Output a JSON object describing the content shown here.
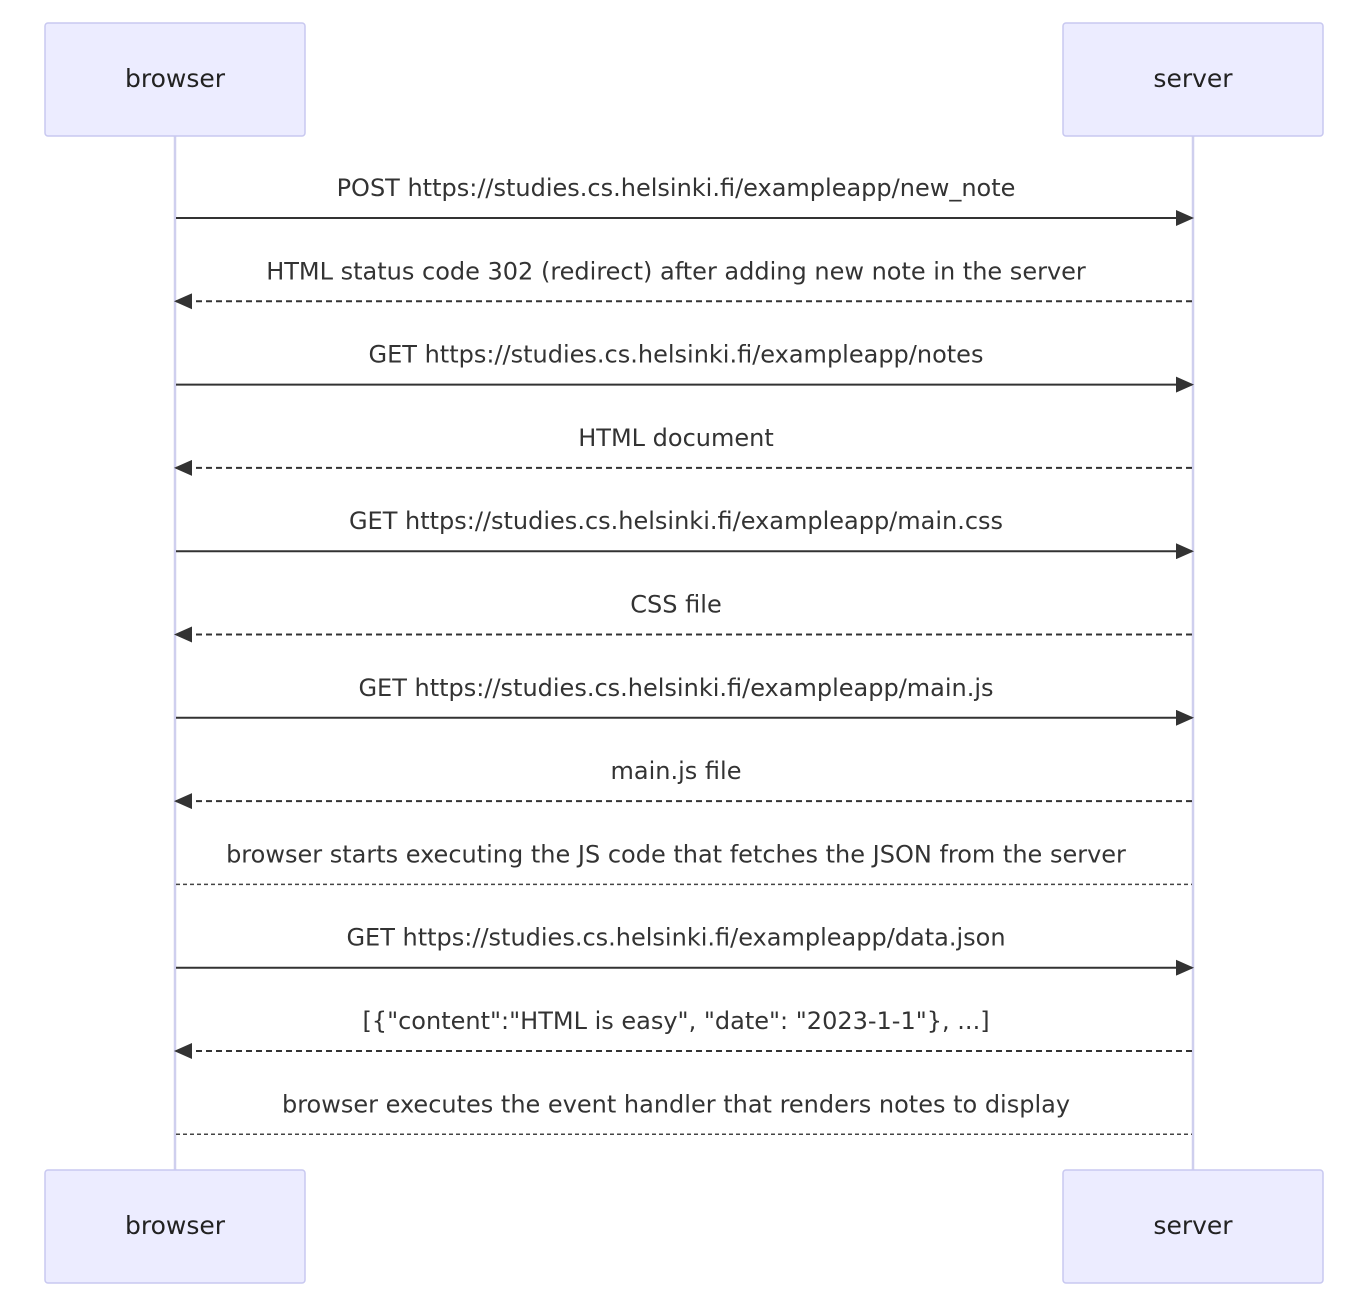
{
  "participants": [
    {
      "id": "browser",
      "label": "browser"
    },
    {
      "id": "server",
      "label": "server"
    }
  ],
  "messages": [
    {
      "kind": "request",
      "label": "POST https://studies.cs.helsinki.fi/exampleapp/new_note"
    },
    {
      "kind": "response",
      "label": "HTML status code 302 (redirect) after adding new note in the server"
    },
    {
      "kind": "request",
      "label": "GET https://studies.cs.helsinki.fi/exampleapp/notes"
    },
    {
      "kind": "response",
      "label": "HTML document"
    },
    {
      "kind": "request",
      "label": "GET https://studies.cs.helsinki.fi/exampleapp/main.css"
    },
    {
      "kind": "response",
      "label": "CSS file"
    },
    {
      "kind": "request",
      "label": "GET https://studies.cs.helsinki.fi/exampleapp/main.js"
    },
    {
      "kind": "response",
      "label": "main.js file"
    },
    {
      "kind": "note",
      "label": "browser starts executing the JS code that fetches the JSON from the server"
    },
    {
      "kind": "request",
      "label": "GET https://studies.cs.helsinki.fi/exampleapp/data.json"
    },
    {
      "kind": "response",
      "label": "[{\"content\":\"HTML is easy\", \"date\": \"2023-1-1\"}, ...]"
    },
    {
      "kind": "note",
      "label": "browser executes the event handler that renders notes to display"
    }
  ],
  "colors": {
    "actor_fill": "#ececff",
    "actor_border": "#c8c8f0",
    "lifeline": "#cfcfee",
    "line": "#333333"
  }
}
